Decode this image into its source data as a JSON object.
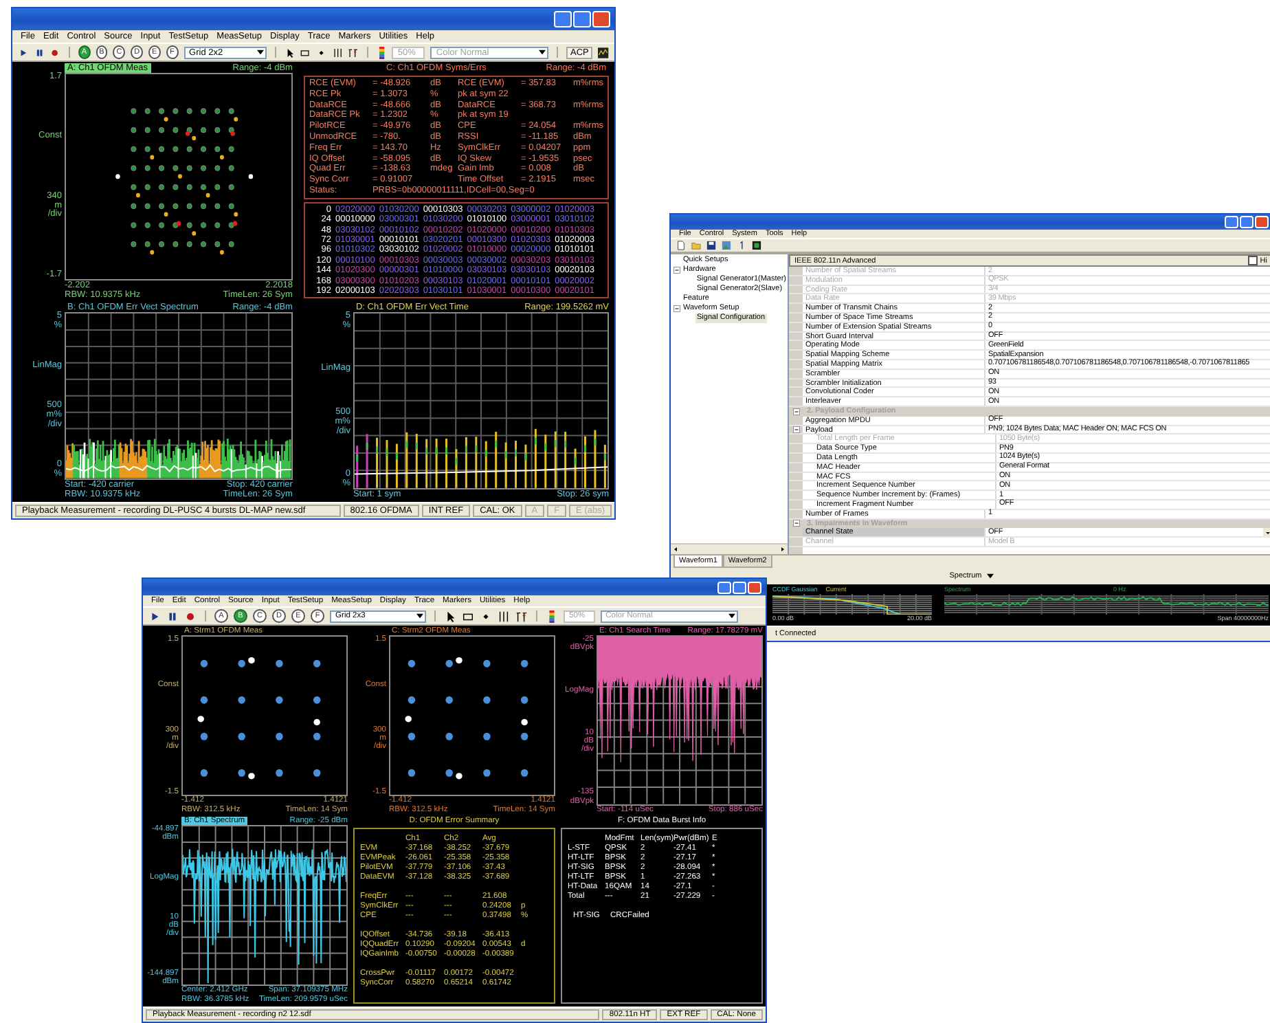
{
  "analyzer_window": {
    "menu": [
      "File",
      "Edit",
      "Control",
      "Source",
      "Input",
      "TestSetup",
      "MeasSetup",
      "Display",
      "Trace",
      "Markers",
      "Utilities",
      "Help"
    ],
    "toolbar": {
      "trace_buttons": [
        {
          "label": "A",
          "selected": true
        },
        {
          "label": "B",
          "selected": false
        },
        {
          "label": "C",
          "selected": false
        },
        {
          "label": "D",
          "selected": false
        },
        {
          "label": "E",
          "selected": false
        },
        {
          "label": "F",
          "selected": false
        }
      ],
      "grid_layout": "Grid 2x2",
      "opacity": "50%",
      "color_mode": "Color Normal",
      "acp_label": "ACP"
    },
    "panel_a": {
      "title": "A: Ch1 OFDM Meas",
      "highlighted": true,
      "range": "Range: -4 dBm",
      "kind": "constellation-64",
      "y_labels": [
        [
          "1.7"
        ],
        [
          "Const"
        ],
        [
          "340",
          "m",
          "/div"
        ],
        [
          "-1.7"
        ]
      ],
      "footer": [
        [
          "-2.202",
          "2.2018"
        ],
        [
          "RBW: 10.9375 kHz",
          "TimeLen: 26 Sym"
        ]
      ]
    },
    "panel_c": {
      "title": "C: Ch1 OFDM Syms/Errs",
      "range": "Range: -4 dBm",
      "measurements": [
        {
          "left": [
            "RCE (EVM)",
            "= -48.926",
            "dB"
          ],
          "right": [
            "RCE (EVM)",
            "= 357.83",
            "m%rms"
          ]
        },
        {
          "left": [
            "RCE Pk",
            "= 1.3073",
            "%"
          ],
          "right": [
            "pk at sym 22"
          ]
        },
        {
          "left": [
            "DataRCE",
            "= -48.666",
            "dB"
          ],
          "right": [
            "DataRCE",
            "= 368.73",
            "m%rms"
          ]
        },
        {
          "left": [
            "DataRCE Pk",
            "= 1.2302",
            "%"
          ],
          "right": [
            "pk at sym 19"
          ]
        },
        {
          "left": [
            "PilotRCE",
            "= -49.976",
            "dB"
          ],
          "right": [
            "CPE",
            "= 24.054",
            "m%rms"
          ]
        },
        {
          "left": [
            "UnmodRCE",
            "= -780.",
            "dB"
          ],
          "right": [
            "RSSI",
            "= -11.185",
            "dBm"
          ]
        },
        {
          "left": [
            "Freq Err",
            "= 143.70",
            "Hz"
          ],
          "right": [
            "SymClkErr",
            "= 0.04207",
            "ppm"
          ]
        },
        {
          "left": [
            "IQ Offset",
            "= -58.095",
            "dB"
          ],
          "right": [
            "IQ Skew",
            "= -1.9535",
            "psec"
          ]
        },
        {
          "left": [
            "Quad Err",
            "= -138.63",
            "mdeg"
          ],
          "right": [
            "Gain Imb",
            "= 0.008",
            "dB"
          ]
        },
        {
          "left": [
            "Sync Corr",
            "= 0.91007"
          ],
          "right": [
            "Time Offset",
            "= 2.1915",
            "msec"
          ]
        }
      ],
      "status": [
        "Status:",
        "PRBS=0b00000011111,IDCell=00,Seg=0"
      ],
      "symbols": [
        {
          "index": "0",
          "groups": [
            "02020000",
            "01030200",
            "00010303",
            "00030203",
            "03000002",
            "01020003"
          ]
        },
        {
          "index": "24",
          "groups": [
            "00010000",
            "03000301",
            "01030200",
            "01010100",
            "03000001",
            "03010102"
          ]
        },
        {
          "index": "48",
          "groups": [
            "03030102",
            "00010102",
            "00010202",
            "01020000",
            "00010200",
            "01010303"
          ]
        },
        {
          "index": "72",
          "groups": [
            "01030001",
            "00010101",
            "03020201",
            "00010300",
            "01020303",
            "01020003"
          ]
        },
        {
          "index": "96",
          "groups": [
            "01010302",
            "03030102",
            "01020002",
            "01010000",
            "00020000",
            "01010101"
          ]
        },
        {
          "index": "120",
          "groups": [
            "00010100",
            "00010303",
            "00030003",
            "00030002",
            "00030203",
            "03010103"
          ]
        },
        {
          "index": "144",
          "groups": [
            "01020300",
            "00000301",
            "01010000",
            "03030103",
            "03030103",
            "00020103"
          ]
        },
        {
          "index": "168",
          "groups": [
            "03000300",
            "01010203",
            "00030103",
            "01020001",
            "00010101",
            "00020002"
          ]
        },
        {
          "index": "192",
          "groups": [
            "02000103",
            "02020303",
            "01030101",
            "01030001",
            "00010300",
            "00020101"
          ]
        }
      ]
    },
    "panel_b": {
      "title": "B: Ch1 OFDM Err Vect Spectrum",
      "highlighted": false,
      "range": "Range: -4 dBm",
      "kind": "error-spectrum",
      "y_labels": [
        [
          "5",
          "%"
        ],
        [
          "LinMag"
        ],
        [
          "500",
          "m%",
          "/div"
        ],
        [
          "0",
          "%"
        ]
      ],
      "footer": [
        [
          "Start: -420 carrier",
          "Stop: 420 carrier"
        ],
        [
          "RBW: 10.9375 kHz",
          "TimeLen: 26 Sym"
        ]
      ]
    },
    "panel_d": {
      "title": "D: Ch1 OFDM Err Vect Time",
      "highlighted": false,
      "range": "Range: 199.5262 mV",
      "kind": "error-time",
      "y_labels": [
        [
          "5",
          "%"
        ],
        [
          "LinMag"
        ],
        [
          "500",
          "m%",
          "/div"
        ],
        [
          "0",
          "%"
        ]
      ],
      "footer": [
        [
          "Start: 1 sym",
          "Stop: 26 sym"
        ]
      ]
    },
    "status_bar": [
      "Playback Measurement - recording DL-PUSC 4 bursts DL-MAP new.sdf",
      "802.16 OFDMA",
      "INT REF",
      "CAL: OK",
      "A",
      "F",
      "E (abs)"
    ]
  },
  "generator_window": {
    "menu": [
      "File",
      "Control",
      "System",
      "Tools",
      "Help"
    ],
    "tree": [
      {
        "label": "Quick Setups",
        "selected": false
      },
      {
        "label": "Hardware",
        "selected": false,
        "expanded": true,
        "children": [
          {
            "label": "Signal Generator1(Master)",
            "selected": false
          },
          {
            "label": "Signal Generator2(Slave)",
            "selected": false
          }
        ]
      },
      {
        "label": "Feature",
        "selected": false
      },
      {
        "label": "Waveform Setup",
        "selected": false,
        "expanded": true,
        "children": [
          {
            "label": "Signal Configuration",
            "selected": true
          }
        ]
      }
    ],
    "grid_title": "IEEE 802.11n  Advanced",
    "grid_checkbox": {
      "label": "Hi",
      "checked": false
    },
    "sections": [
      {
        "rows": [
          {
            "name": "Number of Spatial Streams",
            "value": "2",
            "disabled": true,
            "selected": false
          },
          {
            "name": "Modulation",
            "value": "QPSK",
            "disabled": true,
            "selected": false
          },
          {
            "name": "Coding Rate",
            "value": "3/4",
            "disabled": true,
            "selected": false
          },
          {
            "name": "Data Rate",
            "value": "39 Mbps",
            "disabled": true,
            "selected": false
          },
          {
            "name": "Number of Transmit Chains",
            "value": "2",
            "disabled": false,
            "selected": false
          },
          {
            "name": "Number of Space Time Streams",
            "value": "2",
            "disabled": false,
            "selected": false
          },
          {
            "name": "Number of Extension Spatial Streams",
            "value": "0",
            "disabled": false,
            "selected": false
          },
          {
            "name": "Short Guard Interval",
            "value": "OFF",
            "disabled": false,
            "selected": false
          },
          {
            "name": "Operating Mode",
            "value": "GreenField",
            "disabled": false,
            "selected": false
          },
          {
            "name": "Spatial Mapping Scheme",
            "value": "SpatialExpansion",
            "disabled": false,
            "selected": false
          },
          {
            "name": "Spatial Mapping Matrix",
            "value": "0.707106781186548,0.707106781186548,0.707106781186548,-0.7071067811865",
            "disabled": false,
            "selected": false
          },
          {
            "name": "Scrambler",
            "value": "ON",
            "disabled": false,
            "selected": false
          },
          {
            "name": "Scrambler Initialization",
            "value": "93",
            "disabled": false,
            "selected": false
          },
          {
            "name": "Convolutional Coder",
            "value": "ON",
            "disabled": false,
            "selected": false
          },
          {
            "name": "Interleaver",
            "value": "ON",
            "disabled": false,
            "selected": false
          }
        ]
      },
      {
        "title": "2. Payload Configuration",
        "expanded": true,
        "rows": [
          {
            "name": "Aggregation MPDU",
            "value": "OFF",
            "disabled": false,
            "selected": false
          },
          {
            "name": "Payload",
            "value": "PN9; 1024 Bytes Data; MAC Header ON; MAC FCS ON",
            "disabled": false,
            "selected": false,
            "expanded": true,
            "children": [
              {
                "name": "Total Length per Frame",
                "value": "1050 Byte(s)",
                "disabled": true,
                "selected": false
              },
              {
                "name": "Data Source Type",
                "value": "PN9",
                "disabled": false,
                "selected": false
              },
              {
                "name": "Data Length",
                "value": "1024 Byte(s)",
                "disabled": false,
                "selected": false
              },
              {
                "name": "MAC Header",
                "value": "General Format",
                "disabled": false,
                "selected": false
              },
              {
                "name": "MAC FCS",
                "value": "ON",
                "disabled": false,
                "selected": false
              },
              {
                "name": "Increment Sequence Number",
                "value": "ON",
                "disabled": false,
                "selected": false
              },
              {
                "name": "Sequence Number Increment by: (Frames)",
                "value": "1",
                "disabled": false,
                "selected": false
              },
              {
                "name": "Increment Fragment Number",
                "value": "OFF",
                "disabled": false,
                "selected": false
              }
            ]
          },
          {
            "name": "Number of Frames",
            "value": "1",
            "disabled": false,
            "selected": false
          }
        ]
      },
      {
        "title": "3. Impairments in Waveform",
        "expanded": true,
        "rows": [
          {
            "name": "Channel State",
            "value": "OFF",
            "disabled": false,
            "selected": true
          },
          {
            "name": "Channel",
            "value": "Model B",
            "disabled": true,
            "selected": false
          }
        ]
      }
    ],
    "tabs": [
      {
        "label": "Waveform1",
        "selected": true
      },
      {
        "label": "Waveform2",
        "selected": false
      }
    ],
    "view_dropdown": "Spectrum",
    "ccdf_chart": {
      "legend": [
        "CCDF Gaussian",
        "Current"
      ],
      "x_labels": [
        "0.00 dB",
        "20.00 dB"
      ]
    },
    "spectrum_chart": {
      "title": "Spectrum",
      "center": "0 Hz",
      "span": "Span 40000000Hz"
    },
    "status": "t Connected"
  },
  "mimo_window": {
    "menu": [
      "File",
      "Edit",
      "Control",
      "Source",
      "Input",
      "TestSetup",
      "MeasSetup",
      "Display",
      "Trace",
      "Markers",
      "Utilities",
      "Help"
    ],
    "toolbar": {
      "trace_buttons": [
        {
          "label": "A",
          "selected": false
        },
        {
          "label": "B",
          "selected": true
        },
        {
          "label": "C",
          "selected": false
        },
        {
          "label": "D",
          "selected": false
        },
        {
          "label": "E",
          "selected": false
        },
        {
          "label": "F",
          "selected": false
        }
      ],
      "grid_layout": "Grid 2x3",
      "opacity": "50%",
      "color_mode": "Color Normal"
    },
    "panel_a": {
      "title": "A: Strm1 OFDM Meas",
      "highlighted": false,
      "kind": "constellation-16",
      "y_labels": [
        [
          "1.5"
        ],
        [
          "Const"
        ],
        [
          "300",
          "m",
          "/div"
        ],
        [
          "-1.5"
        ]
      ],
      "footer": [
        [
          "-1.412",
          "1.4121"
        ],
        [
          "RBW: 312.5 kHz",
          "TimeLen: 14 Sym"
        ]
      ]
    },
    "panel_c": {
      "title": "C: Strm2 OFDM Meas",
      "highlighted": false,
      "kind": "constellation-16",
      "y_labels": [
        [
          "1.5"
        ],
        [
          "Const"
        ],
        [
          "300",
          "m",
          "/div"
        ],
        [
          "-1.5"
        ]
      ],
      "footer": [
        [
          "-1.412",
          "1.4121"
        ],
        [
          "RBW: 312.5 kHz",
          "TimeLen: 14 Sym"
        ]
      ]
    },
    "panel_e": {
      "title": "E: Ch1 Search Time",
      "highlighted": false,
      "range": "Range: 17.78279 mV",
      "kind": "search-time",
      "y_labels": [
        [
          "-25",
          "dBVpk"
        ],
        [
          "LogMag"
        ],
        [
          "10",
          "dB",
          "/div"
        ],
        [
          "-135",
          "dBVpk"
        ]
      ],
      "footer": [
        [
          "Start: -114 uSec",
          "Stop: 886 uSec"
        ]
      ]
    },
    "panel_b": {
      "title": "B: Ch1 Spectrum",
      "highlighted": true,
      "range": "Range: -25 dBm",
      "kind": "spectrum",
      "y_labels": [
        [
          "-44.897",
          "dBm"
        ],
        [
          "LogMag"
        ],
        [
          "10",
          "dB",
          "/div"
        ],
        [
          "-144.897",
          "dBm"
        ]
      ],
      "footer": [
        [
          "Center: 2.412 GHz",
          "Span: 37.109375 MHz"
        ],
        [
          "RBW: 36.3785 kHz",
          "TimeLen: 209.9579 uSec"
        ]
      ]
    },
    "error_summary": {
      "title": "D: OFDM Error Summary",
      "columns": [
        "Ch1",
        "Ch2",
        "Avg"
      ],
      "groups": [
        [
          {
            "label": "EVM",
            "values": [
              "-37.168",
              "-38.252",
              "-37.679"
            ]
          },
          {
            "label": "EVMPeak",
            "values": [
              "-26.061",
              "-25.358",
              "-25.358"
            ]
          },
          {
            "label": "PilotEVM",
            "values": [
              "-37.779",
              "-37.106",
              "-37.43"
            ]
          },
          {
            "label": "DataEVM",
            "values": [
              "-37.128",
              "-38.325",
              "-37.689"
            ]
          }
        ],
        [
          {
            "label": "FreqErr",
            "values": [
              "---",
              "---",
              "21.608"
            ]
          },
          {
            "label": "SymClkErr",
            "values": [
              "---",
              "---",
              "0.24208"
            ],
            "unit": "p"
          },
          {
            "label": "CPE",
            "values": [
              "---",
              "---",
              "0.37498"
            ],
            "unit": "%"
          }
        ],
        [
          {
            "label": "IQOffset",
            "values": [
              "-34.736",
              "-39.18",
              "-36.413"
            ]
          },
          {
            "label": "IQQuadErr",
            "values": [
              "0.10290",
              "-0.09204",
              "0.00543"
            ],
            "unit": "d"
          },
          {
            "label": "IQGainImb",
            "values": [
              "-0.00750",
              "-0.00028",
              "-0.00389"
            ]
          }
        ],
        [
          {
            "label": "CrossPwr",
            "values": [
              "-0.01117",
              "0.00172",
              "-0.00472"
            ]
          },
          {
            "label": "SyncCorr",
            "values": [
              "0.58270",
              "0.65214",
              "0.61742"
            ]
          }
        ]
      ]
    },
    "burst_info": {
      "title": "F: OFDM Data Burst Info",
      "columns": [
        "ModFmt",
        "Len(sym)",
        "Pwr(dBm)",
        "E"
      ],
      "rows": [
        {
          "label": "L-STF",
          "values": [
            "QPSK",
            "2",
            "-27.41",
            "*"
          ]
        },
        {
          "label": "HT-LTF",
          "values": [
            "BPSK",
            "2",
            "-27.17",
            "*"
          ]
        },
        {
          "label": "HT-SIG",
          "values": [
            "BPSK",
            "2",
            "-28.094",
            "*"
          ]
        },
        {
          "label": "HT-LTF",
          "values": [
            "BPSK",
            "1",
            "-27.263",
            "*"
          ]
        },
        {
          "label": "HT-Data",
          "values": [
            "16QAM",
            "14",
            "-27.1",
            "-"
          ]
        },
        {
          "label": "Total",
          "values": [
            "---",
            "21",
            "-27.229",
            "-"
          ]
        }
      ],
      "note": [
        "HT-SIG",
        "CRCFailed"
      ]
    },
    "status_bar": [
      "Playback Measurement - recording n2 12.sdf",
      "802.11n HT",
      "EXT REF",
      "CAL: None"
    ]
  }
}
